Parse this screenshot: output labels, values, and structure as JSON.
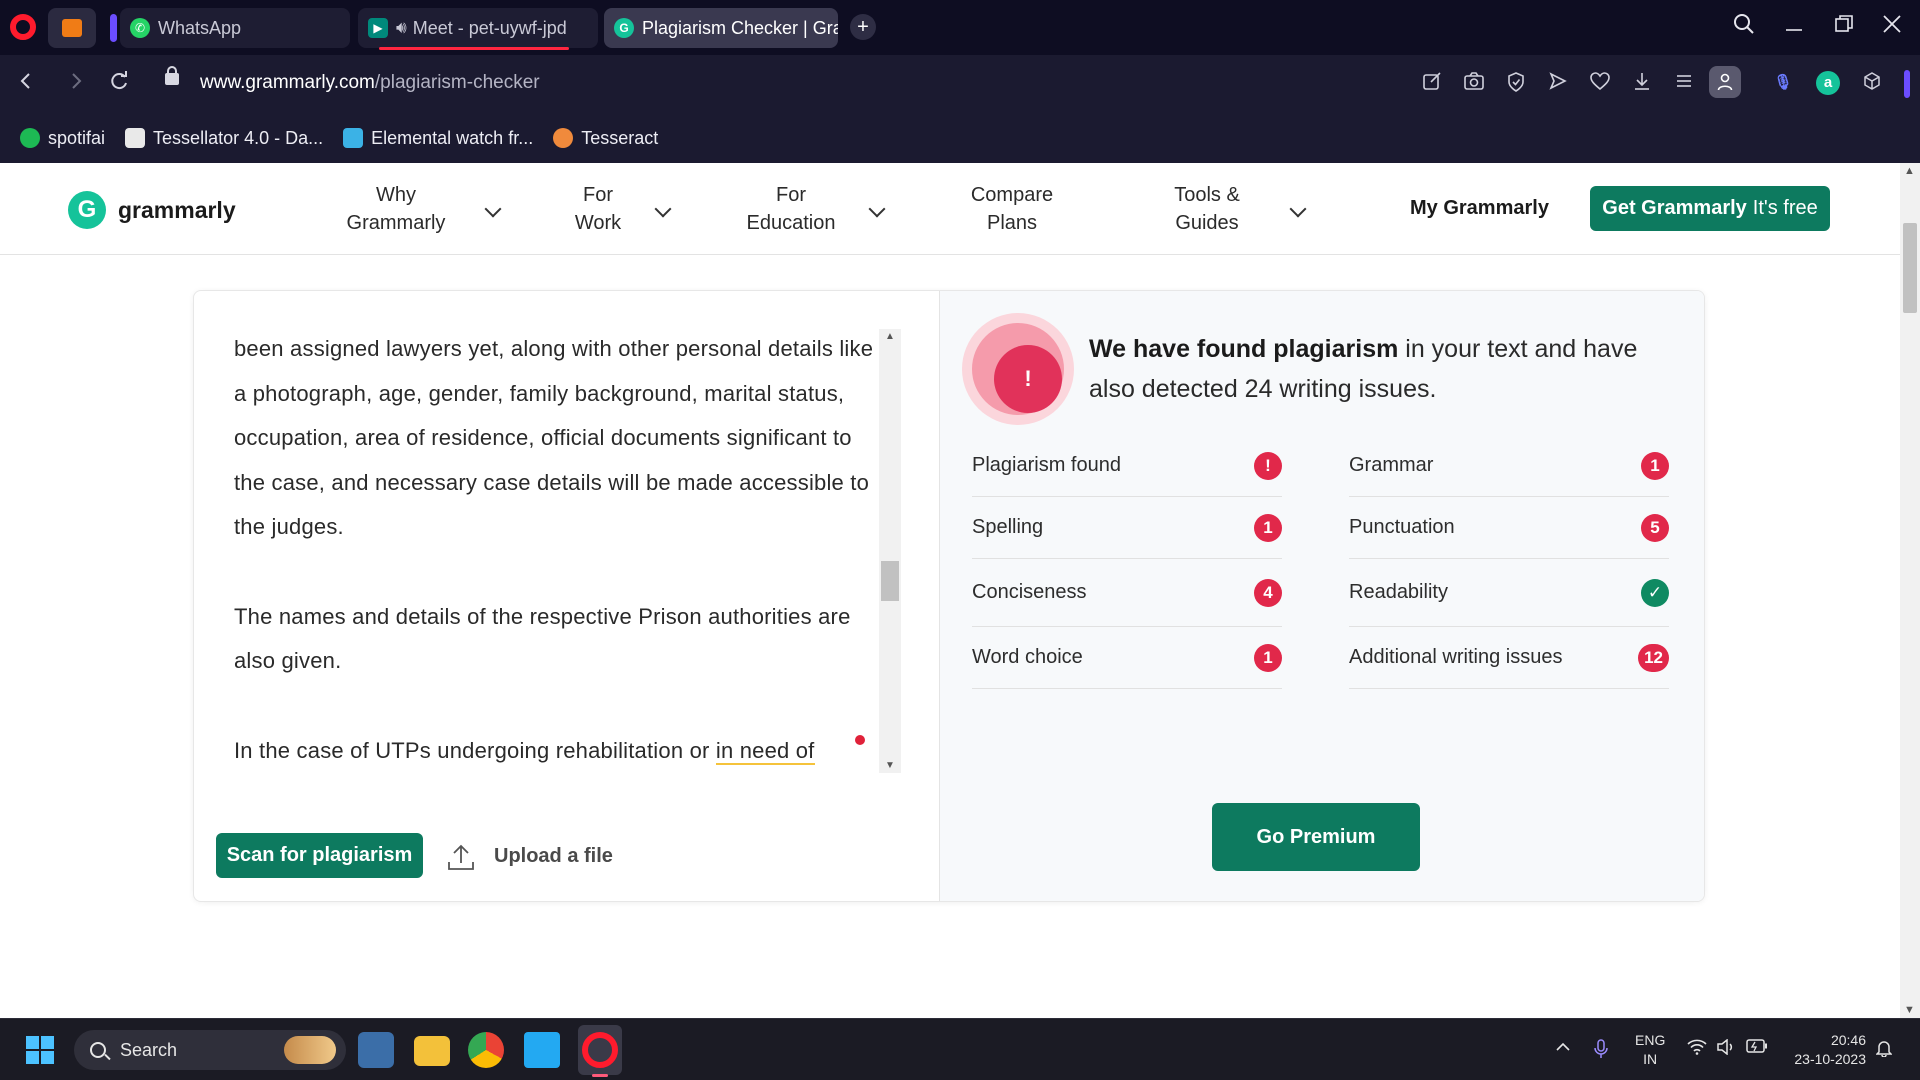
{
  "browser": {
    "tabs": [
      {
        "title": "WhatsApp",
        "favicon_color": "#25d366"
      },
      {
        "title": "Meet - pet-uywf-jpd",
        "favicon_color": "#00897b"
      },
      {
        "title": "Plagiarism Checker | Gra",
        "favicon_color": "#15c39a",
        "active": true
      }
    ],
    "new_tab": "+",
    "url_host": "www.grammarly.com",
    "url_path": "/plagiarism-checker",
    "bookmarks": [
      {
        "label": "spotifai",
        "color": "#1db954"
      },
      {
        "label": "Tessellator 4.0 - Da...",
        "color": "#e9e9e9"
      },
      {
        "label": "Elemental watch fr...",
        "color": "#3bb2e6"
      },
      {
        "label": "Tesseract",
        "color": "#f08a3c"
      }
    ]
  },
  "grammarly": {
    "logo_text": "grammarly",
    "logo_mark": "G",
    "nav": {
      "why_l1": "Why",
      "why_l2": "Grammarly",
      "work_l1": "For",
      "work_l2": "Work",
      "edu_l1": "For",
      "edu_l2": "Education",
      "plans_l1": "Compare",
      "plans_l2": "Plans",
      "tools_l1": "Tools &",
      "tools_l2": "Guides"
    },
    "my_grammarly": "My Grammarly",
    "cta_bold": "Get Grammarly",
    "cta_rest": "It's free"
  },
  "checker": {
    "paragraphs": [
      "been assigned lawyers yet, along with other personal details like a photograph, age, gender, family background, marital status, occupation, area of residence, official documents significant to the case, and necessary case details will be made accessible to the judges.",
      "The names and details of the respective Prison authorities are also given."
    ],
    "last_line_prefix": "In the case of UTPs undergoing rehabilitation or ",
    "last_line_highlight": "in need of",
    "scan_button": "Scan for plagiarism",
    "upload_label": "Upload a file",
    "alert_symbol": "!",
    "result_bold": "We have found plagiarism",
    "result_rest": " in your text and have also detected 24 writing issues.",
    "issues_left": [
      {
        "label": "Plagiarism found",
        "value": "!"
      },
      {
        "label": "Spelling",
        "value": "1"
      },
      {
        "label": "Conciseness",
        "value": "4"
      },
      {
        "label": "Word choice",
        "value": "1"
      }
    ],
    "issues_right": [
      {
        "label": "Grammar",
        "value": "1"
      },
      {
        "label": "Punctuation",
        "value": "5"
      },
      {
        "label": "Readability",
        "value": "✓"
      },
      {
        "label": "Additional writing issues",
        "value": "12"
      }
    ],
    "premium_button": "Go Premium"
  },
  "taskbar": {
    "search_placeholder": "Search",
    "lang_1": "ENG",
    "lang_2": "IN",
    "time": "20:46",
    "date": "23-10-2023"
  }
}
